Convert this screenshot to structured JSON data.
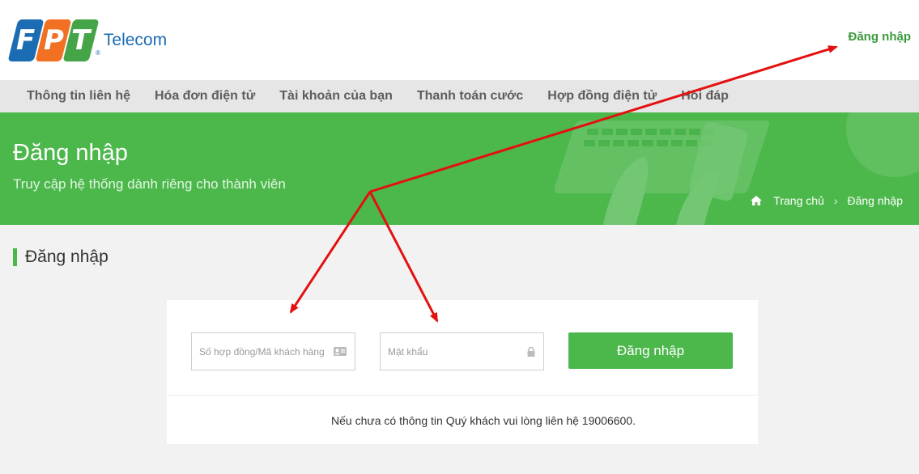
{
  "header": {
    "logo_letters": [
      "F",
      "P",
      "T"
    ],
    "logo_reg": "®",
    "logo_text": "Telecom",
    "login_link": "Đăng nhập"
  },
  "nav": {
    "items": [
      {
        "label": "Thông tin liên hệ"
      },
      {
        "label": "Hóa đơn điện tử"
      },
      {
        "label": "Tài khoản của bạn"
      },
      {
        "label": "Thanh toán cước"
      },
      {
        "label": "Hợp đồng điện tử"
      },
      {
        "label": "Hỏi đáp"
      }
    ]
  },
  "banner": {
    "title": "Đăng nhập",
    "subtitle": "Truy cập hệ thống dành riêng cho thành viên",
    "breadcrumb_home": "Trang chủ",
    "breadcrumb_sep": "›",
    "breadcrumb_current": "Đăng nhập"
  },
  "section": {
    "title": "Đăng nhập"
  },
  "form": {
    "username_placeholder": "Số hợp đồng/Mã khách hàng",
    "username_value": "",
    "password_placeholder": "Mật khẩu",
    "password_value": "",
    "submit_label": "Đăng nhập",
    "note": "Nếu chưa có thông tin Quý khách vui lòng liên hệ 19006600."
  },
  "colors": {
    "brand_green": "#4cb84c",
    "brand_blue": "#1b6cb3",
    "brand_orange": "#f27021",
    "annotation_red": "#e41010"
  },
  "icons": {
    "home": "home-icon",
    "id_card": "id-card-icon",
    "lock": "lock-icon"
  }
}
